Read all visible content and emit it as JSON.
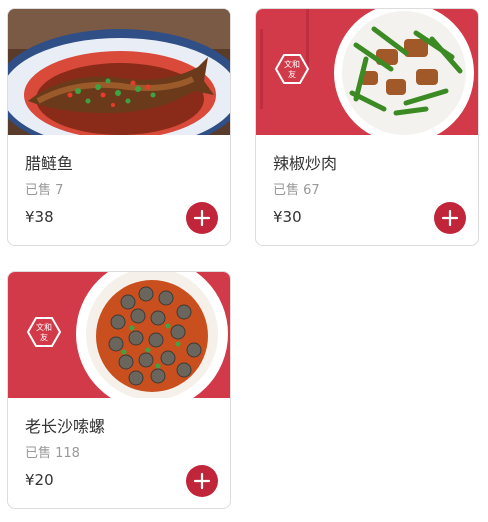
{
  "menu": {
    "items": [
      {
        "name": "腊鲢鱼",
        "sold": "已售 7",
        "price": "¥38",
        "image": "fish-dish"
      },
      {
        "name": "辣椒炒肉",
        "sold": "已售 67",
        "price": "¥30",
        "image": "chili-pork-dish"
      },
      {
        "name": "老长沙嗦螺",
        "sold": "已售 118",
        "price": "¥20",
        "image": "snail-dish"
      }
    ],
    "brand_logo_text": "文和友"
  },
  "colors": {
    "accent": "#c0253a",
    "brand_red": "#d23a4a"
  },
  "icons": {
    "add": "plus-icon"
  }
}
